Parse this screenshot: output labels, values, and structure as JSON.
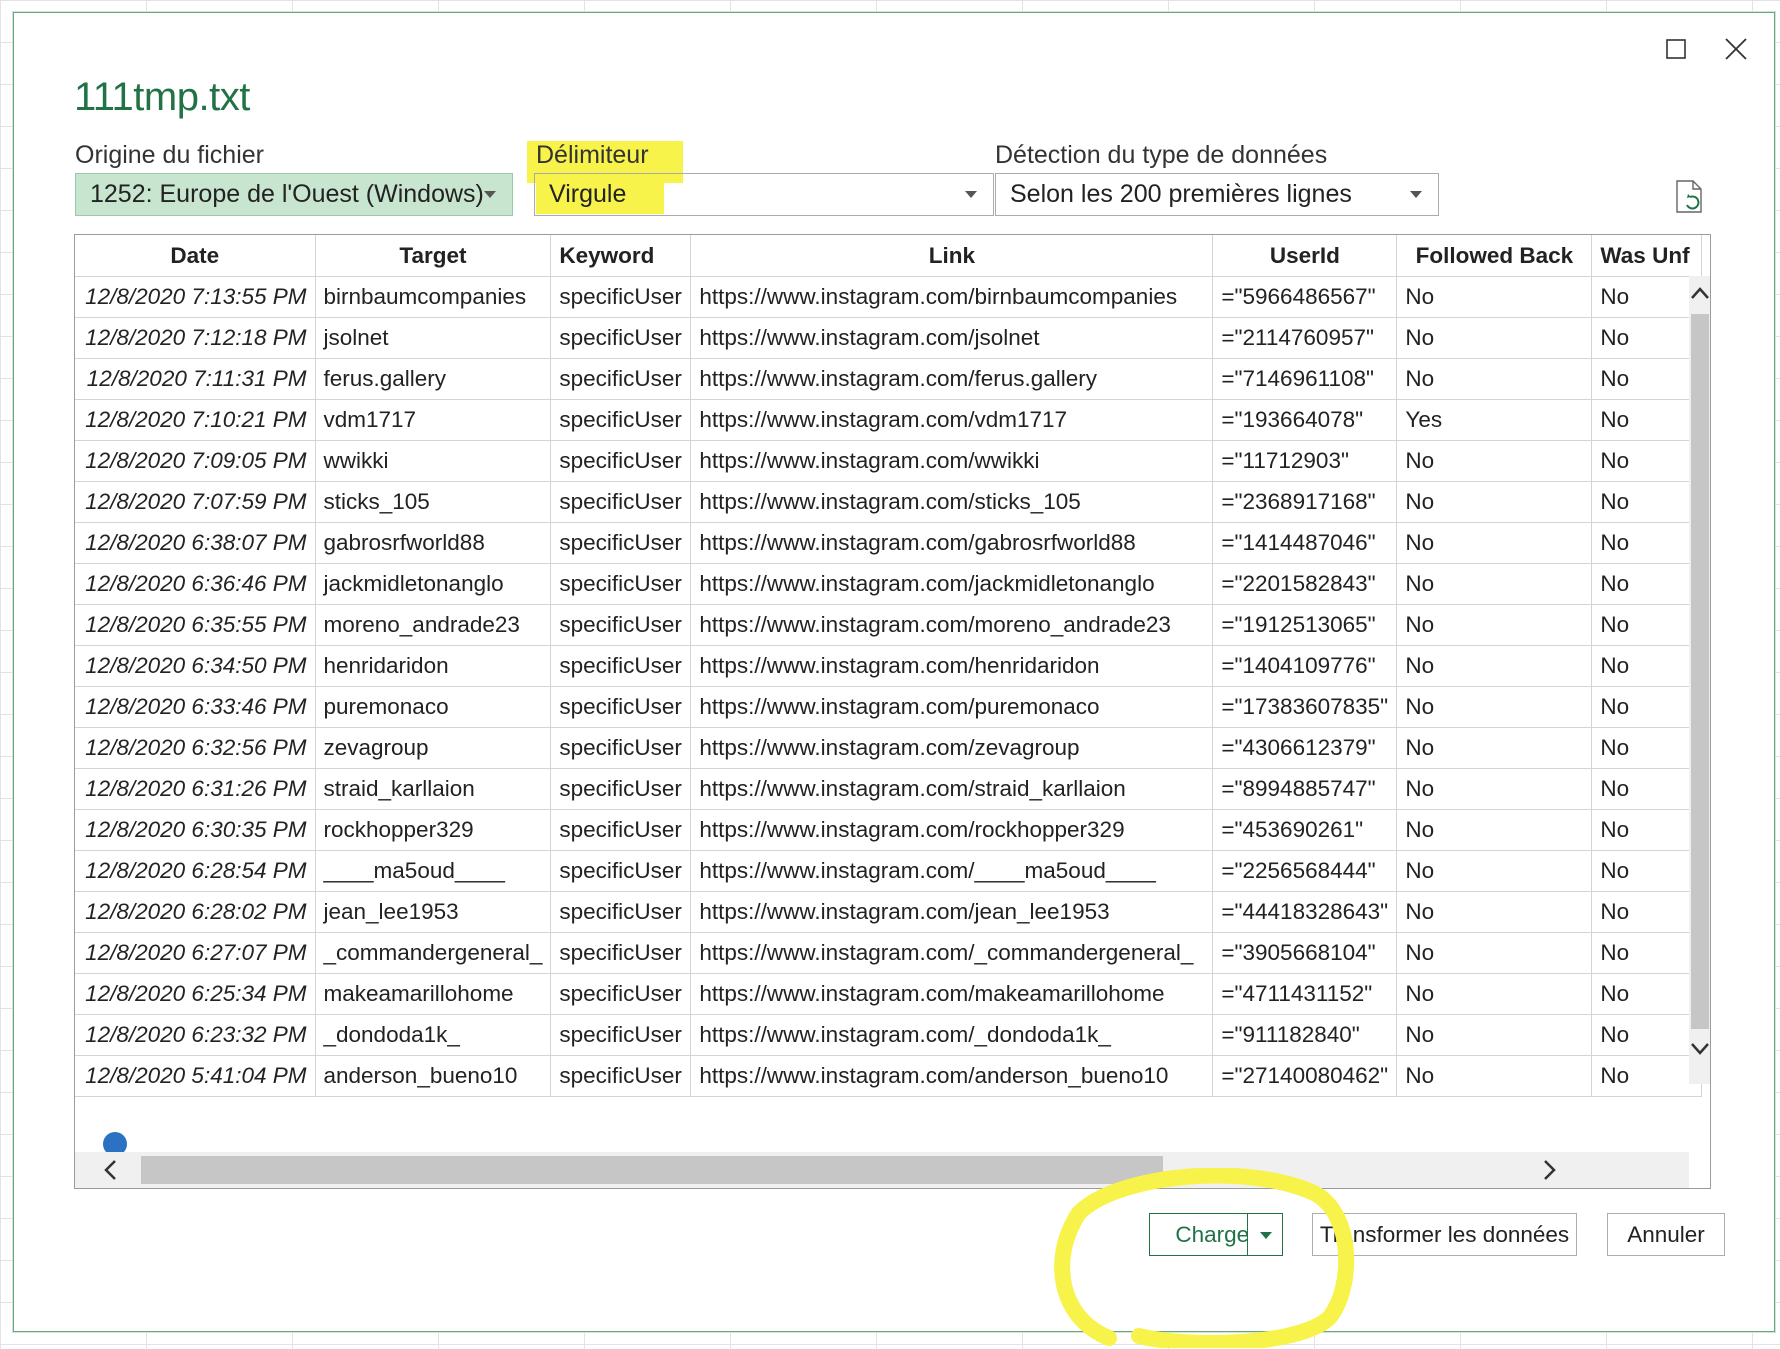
{
  "window": {
    "title": "111tmp.txt",
    "controls": [
      "maximize-icon",
      "close-icon"
    ]
  },
  "options": {
    "origin": {
      "label": "Origine du fichier",
      "value": "1252: Europe de l'Ouest (Windows)"
    },
    "delimiter": {
      "label": "Délimiteur",
      "value": "Virgule"
    },
    "detection": {
      "label": "Détection du type de données",
      "value": "Selon les 200 premières lignes"
    },
    "refresh_icon": "refresh-file-icon"
  },
  "table": {
    "columns": [
      "Date",
      "Target",
      "Keyword",
      "Link",
      "UserId",
      "Followed Back",
      "Was Unf"
    ],
    "rows": [
      [
        "12/8/2020 7:13:55 PM",
        "birnbaumcompanies",
        "specificUser",
        "https://www.instagram.com/birnbaumcompanies",
        "=\"5966486567\"",
        "No",
        "No"
      ],
      [
        "12/8/2020 7:12:18 PM",
        "jsolnet",
        "specificUser",
        "https://www.instagram.com/jsolnet",
        "=\"2114760957\"",
        "No",
        "No"
      ],
      [
        "12/8/2020 7:11:31 PM",
        "ferus.gallery",
        "specificUser",
        "https://www.instagram.com/ferus.gallery",
        "=\"7146961108\"",
        "No",
        "No"
      ],
      [
        "12/8/2020 7:10:21 PM",
        "vdm1717",
        "specificUser",
        "https://www.instagram.com/vdm1717",
        "=\"193664078\"",
        "Yes",
        "No"
      ],
      [
        "12/8/2020 7:09:05 PM",
        "wwikki",
        "specificUser",
        "https://www.instagram.com/wwikki",
        "=\"11712903\"",
        "No",
        "No"
      ],
      [
        "12/8/2020 7:07:59 PM",
        "sticks_105",
        "specificUser",
        "https://www.instagram.com/sticks_105",
        "=\"2368917168\"",
        "No",
        "No"
      ],
      [
        "12/8/2020 6:38:07 PM",
        "gabrosrfworld88",
        "specificUser",
        "https://www.instagram.com/gabrosrfworld88",
        "=\"1414487046\"",
        "No",
        "No"
      ],
      [
        "12/8/2020 6:36:46 PM",
        "jackmidletonanglo",
        "specificUser",
        "https://www.instagram.com/jackmidletonanglo",
        "=\"2201582843\"",
        "No",
        "No"
      ],
      [
        "12/8/2020 6:35:55 PM",
        "moreno_andrade23",
        "specificUser",
        "https://www.instagram.com/moreno_andrade23",
        "=\"1912513065\"",
        "No",
        "No"
      ],
      [
        "12/8/2020 6:34:50 PM",
        "henridaridon",
        "specificUser",
        "https://www.instagram.com/henridaridon",
        "=\"1404109776\"",
        "No",
        "No"
      ],
      [
        "12/8/2020 6:33:46 PM",
        "puremonaco",
        "specificUser",
        "https://www.instagram.com/puremonaco",
        "=\"17383607835\"",
        "No",
        "No"
      ],
      [
        "12/8/2020 6:32:56 PM",
        "zevagroup",
        "specificUser",
        "https://www.instagram.com/zevagroup",
        "=\"4306612379\"",
        "No",
        "No"
      ],
      [
        "12/8/2020 6:31:26 PM",
        "straid_karllaion",
        "specificUser",
        "https://www.instagram.com/straid_karllaion",
        "=\"8994885747\"",
        "No",
        "No"
      ],
      [
        "12/8/2020 6:30:35 PM",
        "rockhopper329",
        "specificUser",
        "https://www.instagram.com/rockhopper329",
        "=\"453690261\"",
        "No",
        "No"
      ],
      [
        "12/8/2020 6:28:54 PM",
        "____ma5oud____",
        "specificUser",
        "https://www.instagram.com/____ma5oud____",
        "=\"2256568444\"",
        "No",
        "No"
      ],
      [
        "12/8/2020 6:28:02 PM",
        "jean_lee1953",
        "specificUser",
        "https://www.instagram.com/jean_lee1953",
        "=\"44418328643\"",
        "No",
        "No"
      ],
      [
        "12/8/2020 6:27:07 PM",
        "_commandergeneral_",
        "specificUser",
        "https://www.instagram.com/_commandergeneral_",
        "=\"3905668104\"",
        "No",
        "No"
      ],
      [
        "12/8/2020 6:25:34 PM",
        "makeamarillohome",
        "specificUser",
        "https://www.instagram.com/makeamarillohome",
        "=\"4711431152\"",
        "No",
        "No"
      ],
      [
        "12/8/2020 6:23:32 PM",
        "_dondoda1k_",
        "specificUser",
        "https://www.instagram.com/_dondoda1k_",
        "=\"911182840\"",
        "No",
        "No"
      ],
      [
        "12/8/2020 5:41:04 PM",
        "anderson_bueno10",
        "specificUser",
        "https://www.instagram.com/anderson_bueno10",
        "=\"27140080462\"",
        "No",
        "No"
      ]
    ]
  },
  "buttons": {
    "load": "Charger",
    "transform": "Transformer les données",
    "cancel": "Annuler"
  },
  "colors": {
    "accent": "#217346",
    "highlight": "#f7f34a",
    "selected_field": "#c8e6cf"
  }
}
